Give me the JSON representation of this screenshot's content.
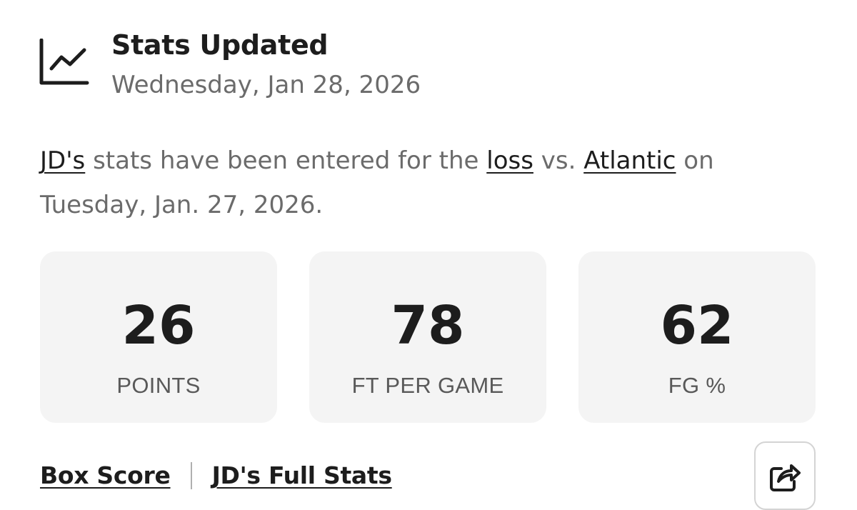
{
  "header": {
    "icon": "line-chart-icon",
    "title": "Stats Updated",
    "date": "Wednesday, Jan 28, 2026"
  },
  "message": {
    "player": "JD's",
    "text_1": " stats have been entered for the ",
    "result": "loss",
    "text_2": " vs. ",
    "opponent": "Atlantic",
    "text_3": " on Tuesday, Jan. 27, 2026."
  },
  "stats": [
    {
      "value": "26",
      "label": "POINTS"
    },
    {
      "value": "78",
      "label": "FT PER GAME"
    },
    {
      "value": "62",
      "label": "FG %"
    }
  ],
  "footer": {
    "box_score": "Box Score",
    "full_stats": "JD's Full Stats",
    "share_icon": "share-icon"
  }
}
